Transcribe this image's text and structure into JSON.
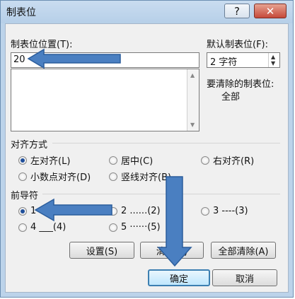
{
  "window": {
    "title": "制表位",
    "help_glyph": "?",
    "close_glyph": "✕"
  },
  "tabpos": {
    "label": "制表位位置(T):",
    "value": "20",
    "list_items": []
  },
  "default_tab": {
    "label": "默认制表位(F):",
    "value": "2 字符"
  },
  "to_clear": {
    "label": "要清除的制表位:",
    "value": "全部"
  },
  "alignment": {
    "title": "对齐方式",
    "options": [
      {
        "label": "左对齐(L)",
        "checked": true
      },
      {
        "label": "居中(C)",
        "checked": false
      },
      {
        "label": "右对齐(R)",
        "checked": false
      },
      {
        "label": "小数点对齐(D)",
        "checked": false
      },
      {
        "label": "竖线对齐(B)",
        "checked": false
      }
    ]
  },
  "leader": {
    "title": "前导符",
    "options": [
      {
        "label": "1",
        "checked": true
      },
      {
        "label": "2 ......(2)",
        "checked": false
      },
      {
        "label": "3 ----(3)",
        "checked": false
      },
      {
        "label": "4 ___(4)",
        "checked": false
      },
      {
        "label": "5 ······(5)",
        "checked": false
      }
    ]
  },
  "buttons": {
    "set": "设置(S)",
    "clear": "清除(E)",
    "clear_all": "全部清除(A)",
    "ok": "确定",
    "cancel": "取消"
  },
  "annotation_color": "#4a7fc1"
}
